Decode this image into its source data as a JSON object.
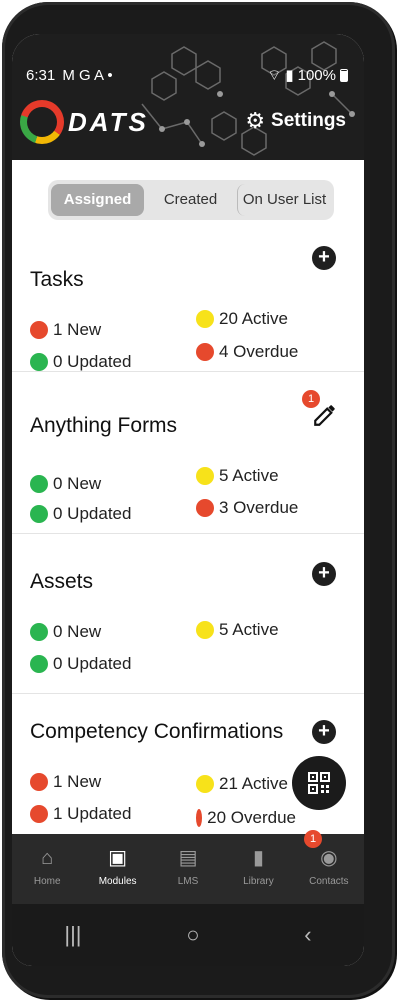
{
  "status_bar": {
    "time": "6:31",
    "indicators": "M G A •",
    "battery": "100%"
  },
  "header": {
    "logo_text": "DATS",
    "settings_label": "Settings"
  },
  "tabs": [
    {
      "label": "Assigned",
      "active": true
    },
    {
      "label": "Created",
      "active": false
    },
    {
      "label": "On User List",
      "active": false
    }
  ],
  "cards": {
    "tasks": {
      "title": "Tasks",
      "new": "1 New",
      "updated": "0 Updated",
      "active": "20 Active",
      "overdue": "4 Overdue"
    },
    "forms": {
      "title": "Anything Forms",
      "badge": "1",
      "new": "0 New",
      "updated": "0 Updated",
      "active": "5 Active",
      "overdue": "3 Overdue"
    },
    "assets": {
      "title": "Assets",
      "new": "0 New",
      "updated": "0 Updated",
      "active": "5 Active"
    },
    "competency": {
      "title": "Competency Confirmations",
      "new": "1 New",
      "updated": "1 Updated",
      "active": "21 Active",
      "overdue": "20 Overdue"
    },
    "next_badge": "1"
  },
  "bottom_nav": [
    {
      "label": "Home",
      "icon": "home-icon"
    },
    {
      "label": "Modules",
      "icon": "inbox-icon",
      "active": true
    },
    {
      "label": "LMS",
      "icon": "book-open-icon"
    },
    {
      "label": "Library",
      "icon": "book-icon"
    },
    {
      "label": "Contacts",
      "icon": "contact-icon"
    }
  ],
  "colors": {
    "red": "#e6492d",
    "green": "#2ab550",
    "yellow": "#f7e21a",
    "header": "#1e1e1e"
  }
}
